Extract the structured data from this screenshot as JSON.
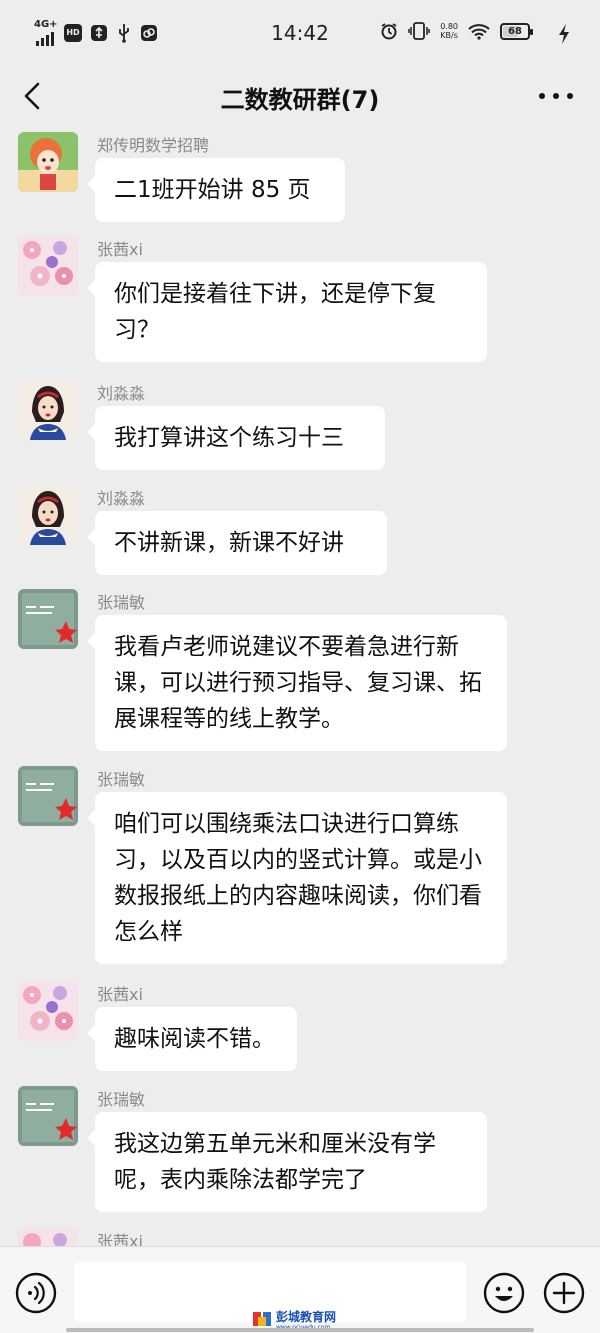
{
  "status_bar": {
    "network": "4G+",
    "hd_badge": "HD",
    "time": "14:42",
    "speed_value": "0.80",
    "speed_unit": "KB/s",
    "battery": "68",
    "battery_level_pct": 68,
    "icons": [
      "signal-icon",
      "usb-icon",
      "usb-debug-icon",
      "link-icon",
      "alarm-icon",
      "vibrate-icon",
      "wifi-icon",
      "battery-icon",
      "charging-icon"
    ]
  },
  "header": {
    "title": "二数教研群(7)",
    "back_icon": "chevron-left-icon",
    "more_icon": "more-dots-icon"
  },
  "messages": [
    {
      "sender": "郑传明数学招聘",
      "text": "二1班开始讲 85 页",
      "avatar": "cartoon-girl"
    },
    {
      "sender": "张茜xi",
      "text": "你们是接着往下讲，还是停下复习？",
      "avatar": "pink-flowers"
    },
    {
      "sender": "刘淼淼",
      "text": "我打算讲这个练习十三",
      "avatar": "snow-white"
    },
    {
      "sender": "刘淼淼",
      "text": "不讲新课，新课不好讲",
      "avatar": "snow-white"
    },
    {
      "sender": "张瑞敏",
      "text": "我看卢老师说建议不要着急进行新课，可以进行预习指导、复习课、拓展课程等的线上教学。",
      "avatar": "green-card"
    },
    {
      "sender": "张瑞敏",
      "text": "咱们可以围绕乘法口诀进行口算练习，以及百以内的竖式计算。或是小数报报纸上的内容趣味阅读，你们看怎么样",
      "avatar": "green-card"
    },
    {
      "sender": "张茜xi",
      "text": "趣味阅读不错。",
      "avatar": "pink-flowers"
    },
    {
      "sender": "张瑞敏",
      "text": "我这边第五单元米和厘米没有学呢，表内乘除法都学完了",
      "avatar": "green-card"
    },
    {
      "sender": "张茜xi",
      "text": "",
      "avatar": "pink-flowers"
    }
  ],
  "input_bar": {
    "placeholder": "",
    "voice_icon": "voice-icon",
    "emoji_icon": "emoji-icon",
    "plus_icon": "plus-icon"
  },
  "watermark": {
    "text": "彭城教育网",
    "url_text": "www.pcjyedu.com"
  },
  "colors": {
    "background": "#ededed",
    "bubble": "#ffffff",
    "sender_name": "#8a8a8a",
    "title": "#111111"
  }
}
